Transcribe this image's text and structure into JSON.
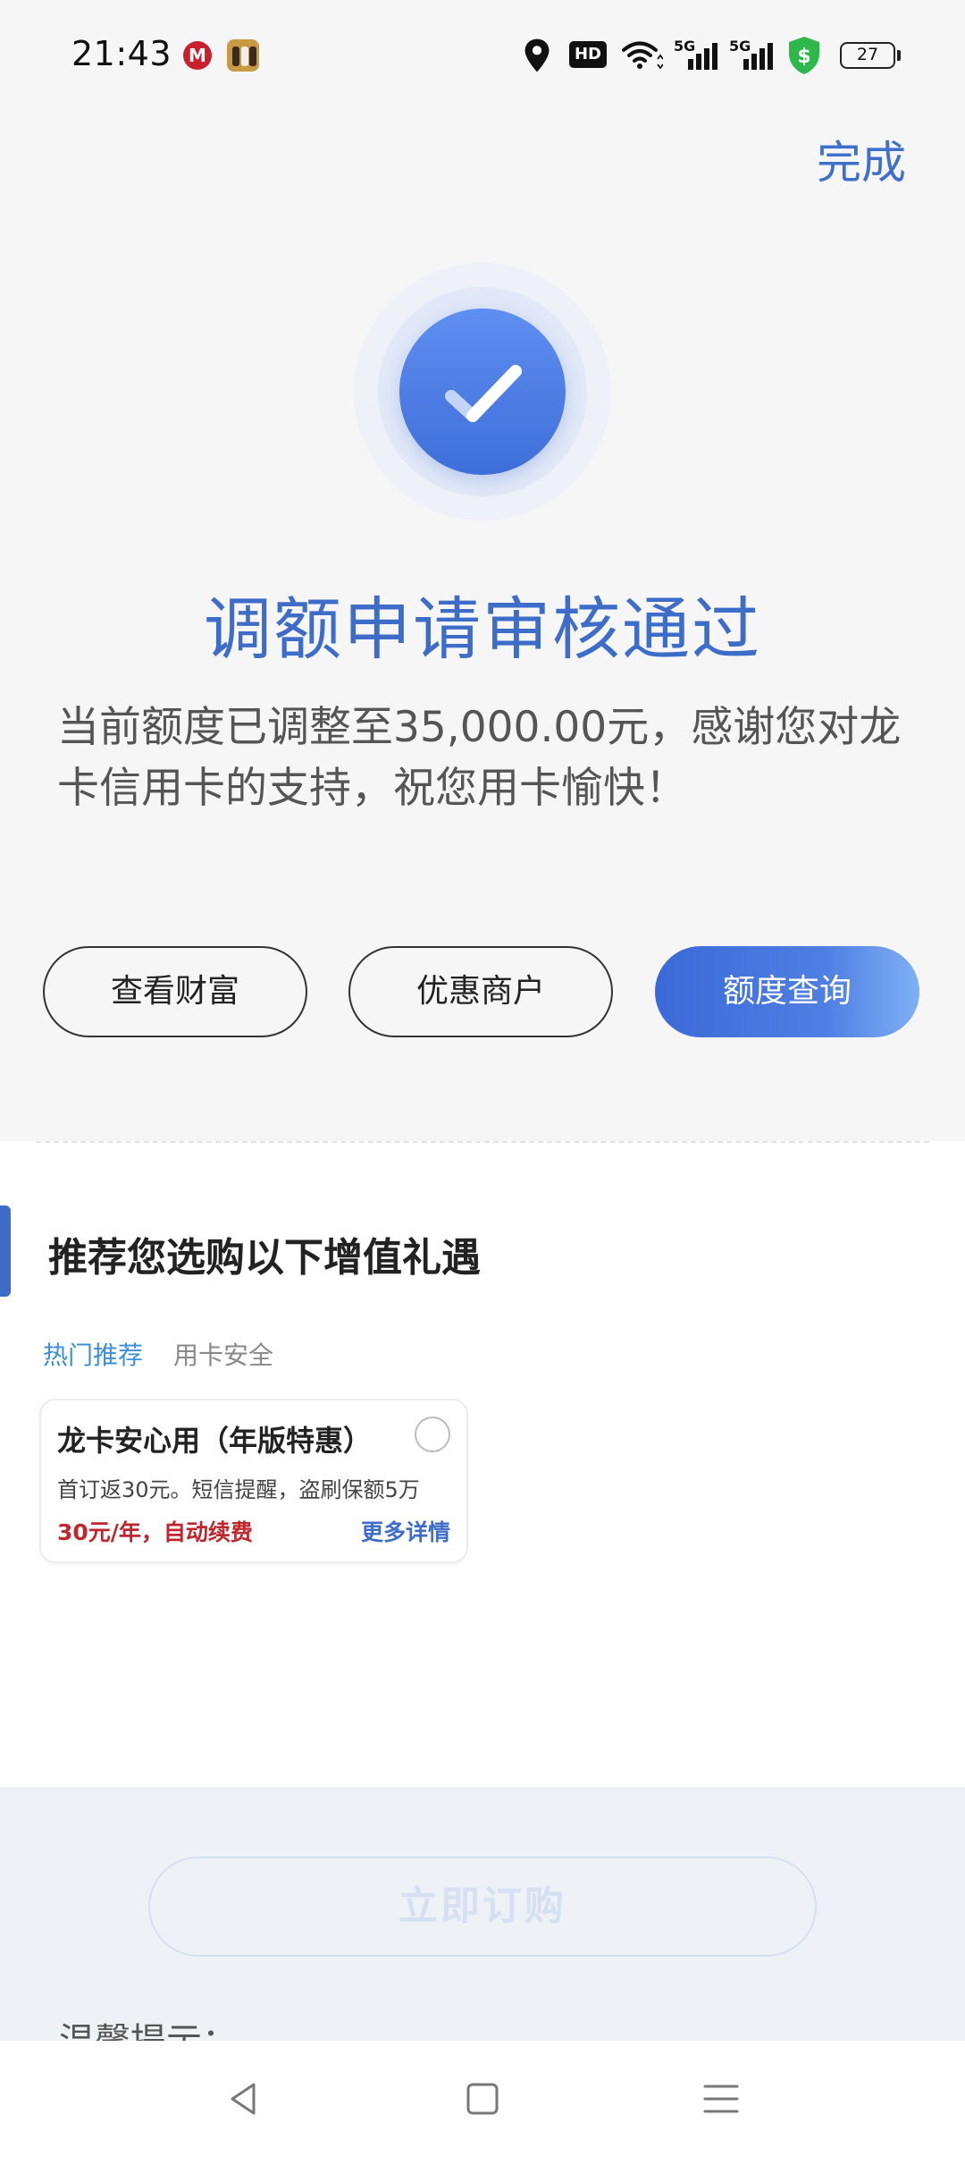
{
  "status_bar": {
    "time": "21:43",
    "app_icon_1": "M",
    "hd_label": "HD",
    "network_1": "5G",
    "network_2": "5G",
    "battery": "27",
    "icons": [
      "location-icon",
      "wifi-icon",
      "signal-icon",
      "shield-dollar-icon",
      "battery-icon"
    ]
  },
  "header": {
    "done_label": "完成"
  },
  "result": {
    "title": "调额申请审核通过",
    "description": "当前额度已调整至35,000.00元，感谢您对龙卡信用卡的支持，祝您用卡愉快！"
  },
  "actions": [
    {
      "label": "查看财富"
    },
    {
      "label": "优惠商户"
    },
    {
      "label": "额度查询"
    }
  ],
  "recommend": {
    "title": "推荐您选购以下增值礼遇",
    "tabs": [
      {
        "label": "热门推荐",
        "active": true
      },
      {
        "label": "用卡安全",
        "active": false
      }
    ],
    "card": {
      "title": "龙卡安心用（年版特惠）",
      "description": "首订返30元。短信提醒，盗刷保额5万",
      "price": "30元/年，自动续费",
      "more": "更多详情"
    }
  },
  "footer": {
    "buy_label": "立即订购",
    "tips_label": "温馨提示："
  },
  "colors": {
    "accent": "#3d6dc8",
    "price": "#c0262d",
    "tab_active": "#3a8fd8"
  }
}
